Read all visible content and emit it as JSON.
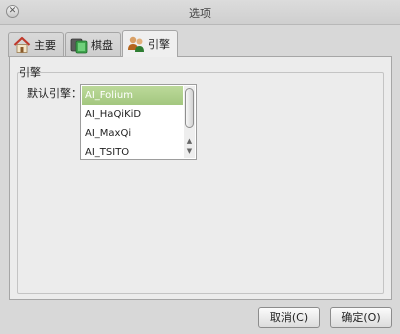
{
  "window": {
    "title": "选项",
    "close_glyph": "✕"
  },
  "tabs": [
    {
      "label": "主要",
      "icon": "home-icon"
    },
    {
      "label": "棋盘",
      "icon": "board-icon"
    },
    {
      "label": "引擎",
      "icon": "engine-users-icon",
      "active": true
    }
  ],
  "engine_group": {
    "title": "引擎",
    "default_label": "默认引擎：",
    "items": [
      "AI_Folium",
      "AI_HaQiKiD",
      "AI_MaxQi",
      "AI_TSITO"
    ],
    "selected": "AI_Folium",
    "scroll_up_glyph": "▲",
    "scroll_down_glyph": "▼"
  },
  "buttons": {
    "cancel": "取消(C)",
    "ok": "确定(O)"
  },
  "colors": {
    "selection": "#a3c77f",
    "background": "#d8d8d8"
  }
}
